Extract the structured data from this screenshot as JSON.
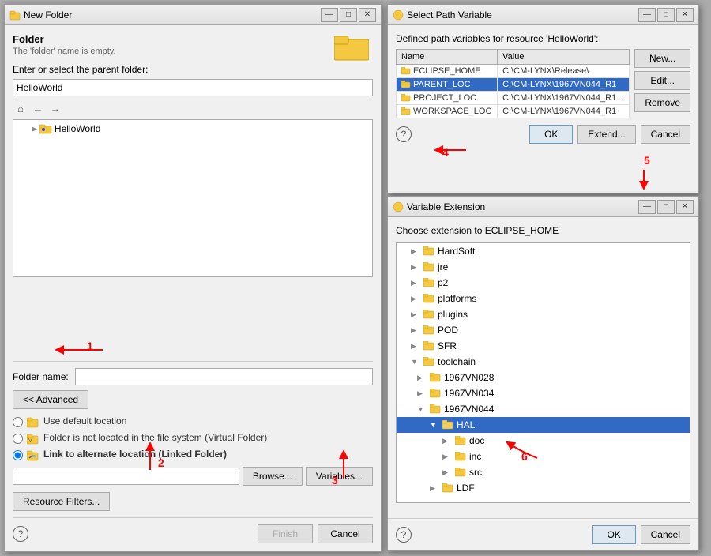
{
  "newFolderWindow": {
    "title": "New Folder",
    "sectionTitle": "Folder",
    "subtitle": "The 'folder' name is empty.",
    "parentFolderLabel": "Enter or select the parent folder:",
    "parentFolderValue": "HelloWorld",
    "treeItem": "HelloWorld",
    "separatorLine": "",
    "folderNameLabel": "Folder name:",
    "folderNameValue": "",
    "advancedBtn": "<< Advanced",
    "radioOptions": [
      {
        "id": "r1",
        "label": "Use default location",
        "checked": false
      },
      {
        "id": "r2",
        "label": "Folder is not located in the file system (Virtual Folder)",
        "checked": false
      },
      {
        "id": "r3",
        "label": "Link to alternate location (Linked Folder)",
        "checked": true
      }
    ],
    "browseBtn": "Browse...",
    "variablesBtn": "Variables...",
    "resourceFiltersBtn": "Resource Filters...",
    "finishBtn": "Finish",
    "cancelBtn": "Cancel",
    "helpIcon": "?"
  },
  "selectPathWindow": {
    "title": "Select Path Variable",
    "headerText": "Defined path variables for resource 'HelloWorld':",
    "tableHeaders": [
      "Name",
      "Value"
    ],
    "tableRows": [
      {
        "name": "ECLIPSE_HOME",
        "value": "C:\\CM-LYNX\\Release\\",
        "selected": false
      },
      {
        "name": "PARENT_LOC",
        "value": "C:\\CM-LYNX\\1967VN044_R1",
        "selected": true
      },
      {
        "name": "PROJECT_LOC",
        "value": "C:\\CM-LYNX\\1967VN044_R1...",
        "selected": false
      },
      {
        "name": "WORKSPACE_LOC",
        "value": "C:\\CM-LYNX\\1967VN044_R1",
        "selected": false
      }
    ],
    "newBtn": "New...",
    "editBtn": "Edit...",
    "removeBtn": "Remove",
    "okBtn": "OK",
    "extendBtn": "Extend...",
    "cancelBtn": "Cancel",
    "helpIcon": "?"
  },
  "variableExtensionWindow": {
    "title": "Variable Extension",
    "headerText": "Choose extension to ECLIPSE_HOME",
    "treeItems": [
      {
        "label": "HardSoft",
        "level": 0,
        "type": "folder",
        "expanded": false
      },
      {
        "label": "jre",
        "level": 0,
        "type": "folder",
        "expanded": false
      },
      {
        "label": "p2",
        "level": 0,
        "type": "folder",
        "expanded": false
      },
      {
        "label": "platforms",
        "level": 0,
        "type": "folder",
        "expanded": false
      },
      {
        "label": "plugins",
        "level": 0,
        "type": "folder",
        "expanded": false
      },
      {
        "label": "POD",
        "level": 0,
        "type": "folder",
        "expanded": false
      },
      {
        "label": "SFR",
        "level": 0,
        "type": "folder",
        "expanded": false
      },
      {
        "label": "toolchain",
        "level": 0,
        "type": "folder",
        "expanded": true
      },
      {
        "label": "1967VN028",
        "level": 1,
        "type": "folder",
        "expanded": false
      },
      {
        "label": "1967VN034",
        "level": 1,
        "type": "folder",
        "expanded": false
      },
      {
        "label": "1967VN044",
        "level": 1,
        "type": "folder",
        "expanded": true
      },
      {
        "label": "HAL",
        "level": 2,
        "type": "folder",
        "expanded": true,
        "selected": true
      },
      {
        "label": "doc",
        "level": 3,
        "type": "folder",
        "expanded": false
      },
      {
        "label": "inc",
        "level": 3,
        "type": "folder",
        "expanded": false
      },
      {
        "label": "src",
        "level": 3,
        "type": "folder",
        "expanded": false
      },
      {
        "label": "LDF",
        "level": 2,
        "type": "folder",
        "expanded": false
      }
    ],
    "okBtn": "OK",
    "cancelBtn": "Cancel",
    "helpIcon": "?"
  },
  "annotations": {
    "arrow1": "1",
    "arrow2": "2",
    "arrow3": "3",
    "arrow4": "4",
    "arrow5": "5",
    "arrow6": "6"
  },
  "icons": {
    "folder": "📁",
    "folderOpen": "📂",
    "settings": "⚙️",
    "minimize": "—",
    "maximize": "□",
    "close": "✕",
    "expand": "▶",
    "collapse": "▼",
    "home": "⌂",
    "back": "←",
    "forward": "→"
  }
}
